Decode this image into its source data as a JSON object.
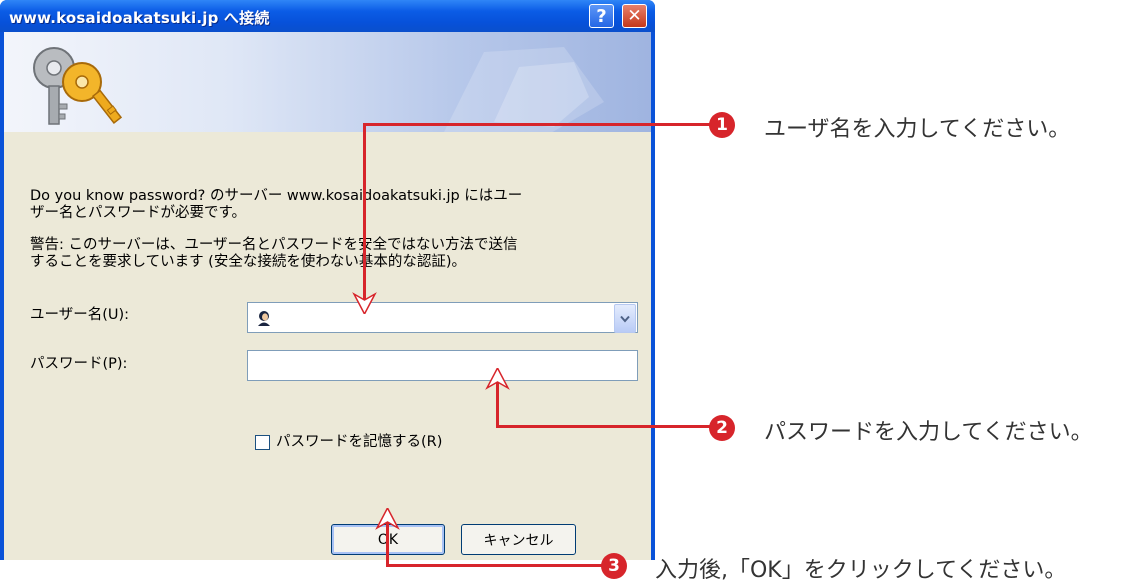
{
  "dialog": {
    "title": "www.kosaidoakatsuki.jp へ接続",
    "help_glyph": "?",
    "close_glyph": "✕",
    "message1_line1": "Do you know password? のサーバー www.kosaidoakatsuki.jp にはユー",
    "message1_line2": "ザー名とパスワードが必要です。",
    "message2_line1": "警告: このサーバーは、ユーザー名とパスワードを安全ではない方法で送信",
    "message2_line2": "することを要求しています (安全な接続を使わない基本的な認証)。",
    "username_label": "ユーザー名(U):",
    "username_value": "",
    "password_label": "パスワード(P):",
    "password_value": "",
    "remember_label": "パスワードを記憶する(R)",
    "remember_checked": false,
    "ok_label": "OK",
    "cancel_label": "キャンセル"
  },
  "annotations": [
    {
      "number": "1",
      "text": "ユーザ名を入力してください。"
    },
    {
      "number": "2",
      "text": "パスワードを入力してください。"
    },
    {
      "number": "3",
      "text": "入力後,「OK」をクリックしてください。"
    }
  ],
  "colors": {
    "annotation": "#d7252b",
    "titlebar": "#0b5ce6",
    "dialog_face": "#ece9d8"
  }
}
